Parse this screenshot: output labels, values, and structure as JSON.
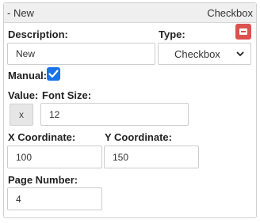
{
  "header": {
    "title": "- New",
    "type_label": "Checkbox"
  },
  "description": {
    "label": "Description:",
    "value": "New"
  },
  "type": {
    "label": "Type:",
    "selected": "Checkbox"
  },
  "manual": {
    "label": "Manual:",
    "checked": true
  },
  "value_label": "Value:",
  "font_size": {
    "label": "Font Size:",
    "value": "12",
    "prefix": "x"
  },
  "x_coordinate": {
    "label": "X Coordinate:",
    "value": "100"
  },
  "y_coordinate": {
    "label": "Y Coordinate:",
    "value": "150"
  },
  "page_number": {
    "label": "Page Number:",
    "value": "4"
  },
  "colors": {
    "remove_button": "#d9534f",
    "checkbox_accent": "#1a73e8"
  }
}
